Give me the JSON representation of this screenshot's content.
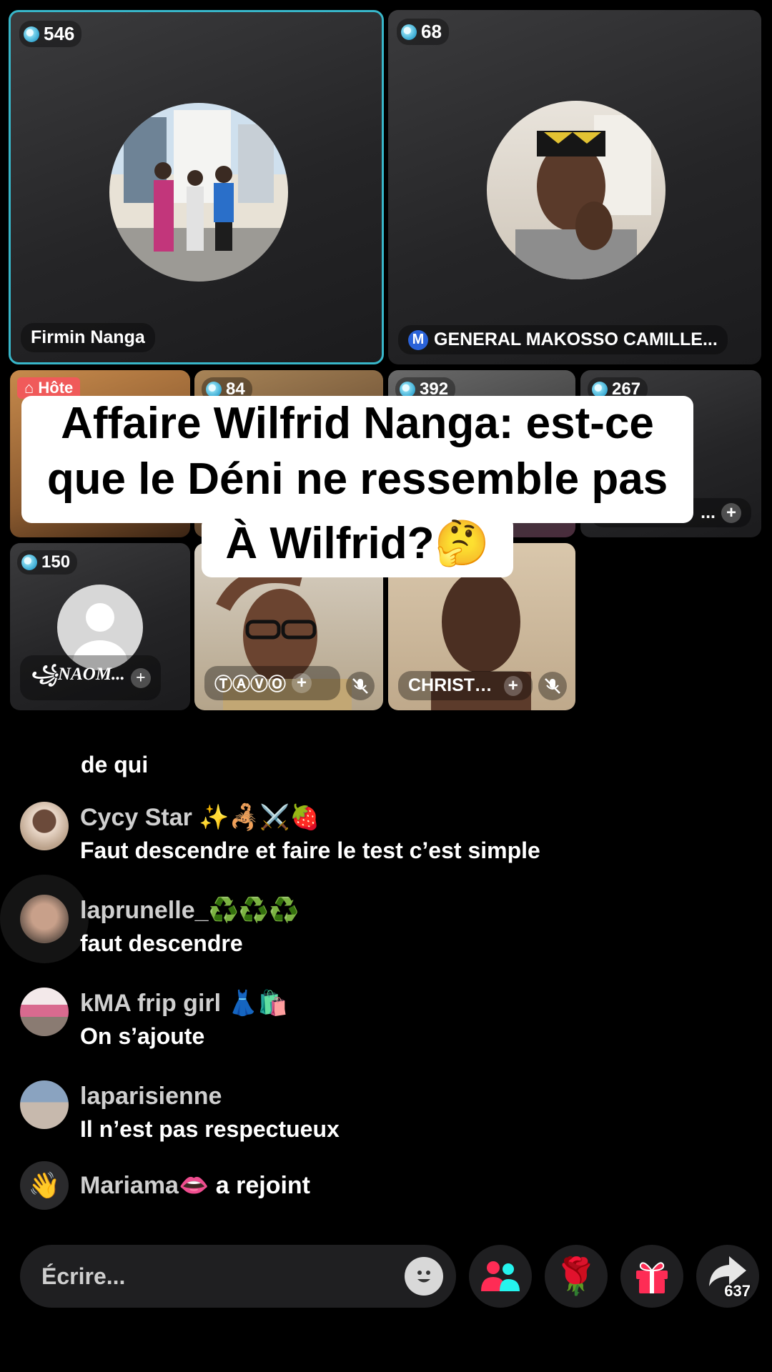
{
  "guests": {
    "tile1": {
      "count": "546",
      "name": "Firmin Nanga"
    },
    "tile2": {
      "count": "68",
      "badge": "M",
      "name": "GENERAL MAKOSSO CAMILLE..."
    },
    "tile3": {
      "host_label": "Hôte"
    },
    "tile4": {
      "count": "84"
    },
    "tile5": {
      "count": "392"
    },
    "tile6": {
      "count": "267",
      "name": "..."
    },
    "tile7": {
      "count": "150",
      "name": "꧁NAOM..."
    },
    "tile8": {
      "name": "ⓉⒶⓋⓄ"
    },
    "tile9": {
      "name": "CHRISTO..."
    }
  },
  "caption": {
    "line1": "Affaire Wilfrid Nanga: est-ce",
    "line2": "que le Déni ne ressemble pas",
    "line3": "À Wilfrid?🤔"
  },
  "comments": [
    {
      "user": "",
      "text": "de qui"
    },
    {
      "user": "Cycy Star ✨🦂⚔️🍓",
      "text": "Faut descendre et faire le test c’est simple"
    },
    {
      "user": "laprunelle_♻️♻️♻️",
      "text": "faut descendre"
    },
    {
      "user": "kMA frip girl 👗🛍️",
      "text": "On s’ajoute"
    },
    {
      "user": "laparisienne",
      "text": "Il n’est pas respectueux"
    }
  ],
  "join": {
    "user": "Mariama👄",
    "action": "a rejoint"
  },
  "composer": {
    "placeholder": "Écrire..."
  },
  "share": {
    "count": "637"
  },
  "colors": {
    "active_border": "#38b6c9",
    "accent_pink": "#fe2c55",
    "accent_cyan": "#25f4ee"
  }
}
